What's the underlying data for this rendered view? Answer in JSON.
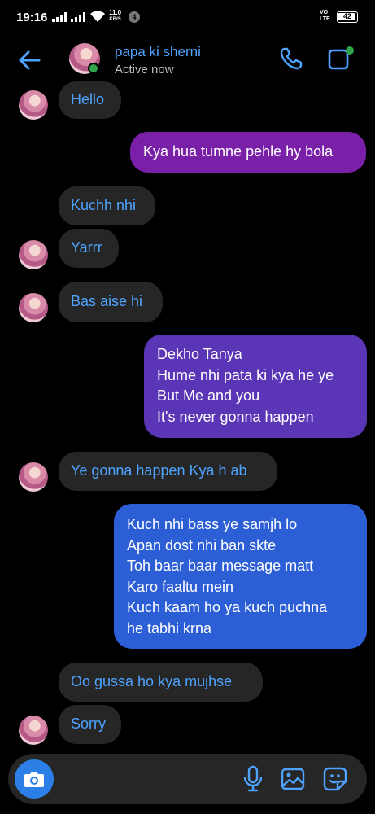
{
  "status_bar": {
    "time": "19:16",
    "net_speed_value": "11.0",
    "net_speed_unit": "KB/S",
    "notification_count": "4",
    "volte_top": "VO",
    "volte_bottom": "LTE",
    "battery": "42"
  },
  "header": {
    "contact_name": "papa ki sherni",
    "status": "Active now",
    "icons": [
      "back-arrow-icon",
      "phone-icon",
      "video-camera-icon"
    ]
  },
  "messages": [
    {
      "direction": "in",
      "text": "Hello"
    },
    {
      "direction": "out",
      "text": "Kya hua tumne pehle hy bola"
    },
    {
      "direction": "in",
      "text": "Kuchh nhi"
    },
    {
      "direction": "in",
      "text": "Yarrr"
    },
    {
      "direction": "in",
      "text": "Bas aise hi"
    },
    {
      "direction": "out",
      "lines": [
        "Dekho Tanya",
        "Hume nhi pata ki kya he ye",
        "But Me and you",
        "It's never gonna happen"
      ]
    },
    {
      "direction": "in",
      "text": "Ye gonna happen Kya h ab"
    },
    {
      "direction": "out",
      "lines": [
        "Kuch nhi bass ye samjh lo",
        "Apan dost nhi ban skte",
        "Toh baar baar message matt",
        "Karo faaltu mein",
        "Kuch kaam ho ya kuch puchna",
        "he tabhi krna"
      ]
    },
    {
      "direction": "in",
      "text": "Oo gussa ho kya mujhse"
    },
    {
      "direction": "in",
      "text": "Sorry"
    }
  ],
  "composer": {
    "icons": [
      "camera-icon",
      "microphone-icon",
      "image-icon",
      "sticker-icon"
    ]
  },
  "colors": {
    "background": "#000000",
    "incoming_bubble": "#262626",
    "incoming_text": "#4ea3ff",
    "outgoing_bubble_1": "#7a1fa8",
    "outgoing_bubble_2": "#5a35b5",
    "outgoing_bubble_3": "#2c5ed6",
    "accent": "#4ea3ff",
    "online": "#31a24c"
  }
}
